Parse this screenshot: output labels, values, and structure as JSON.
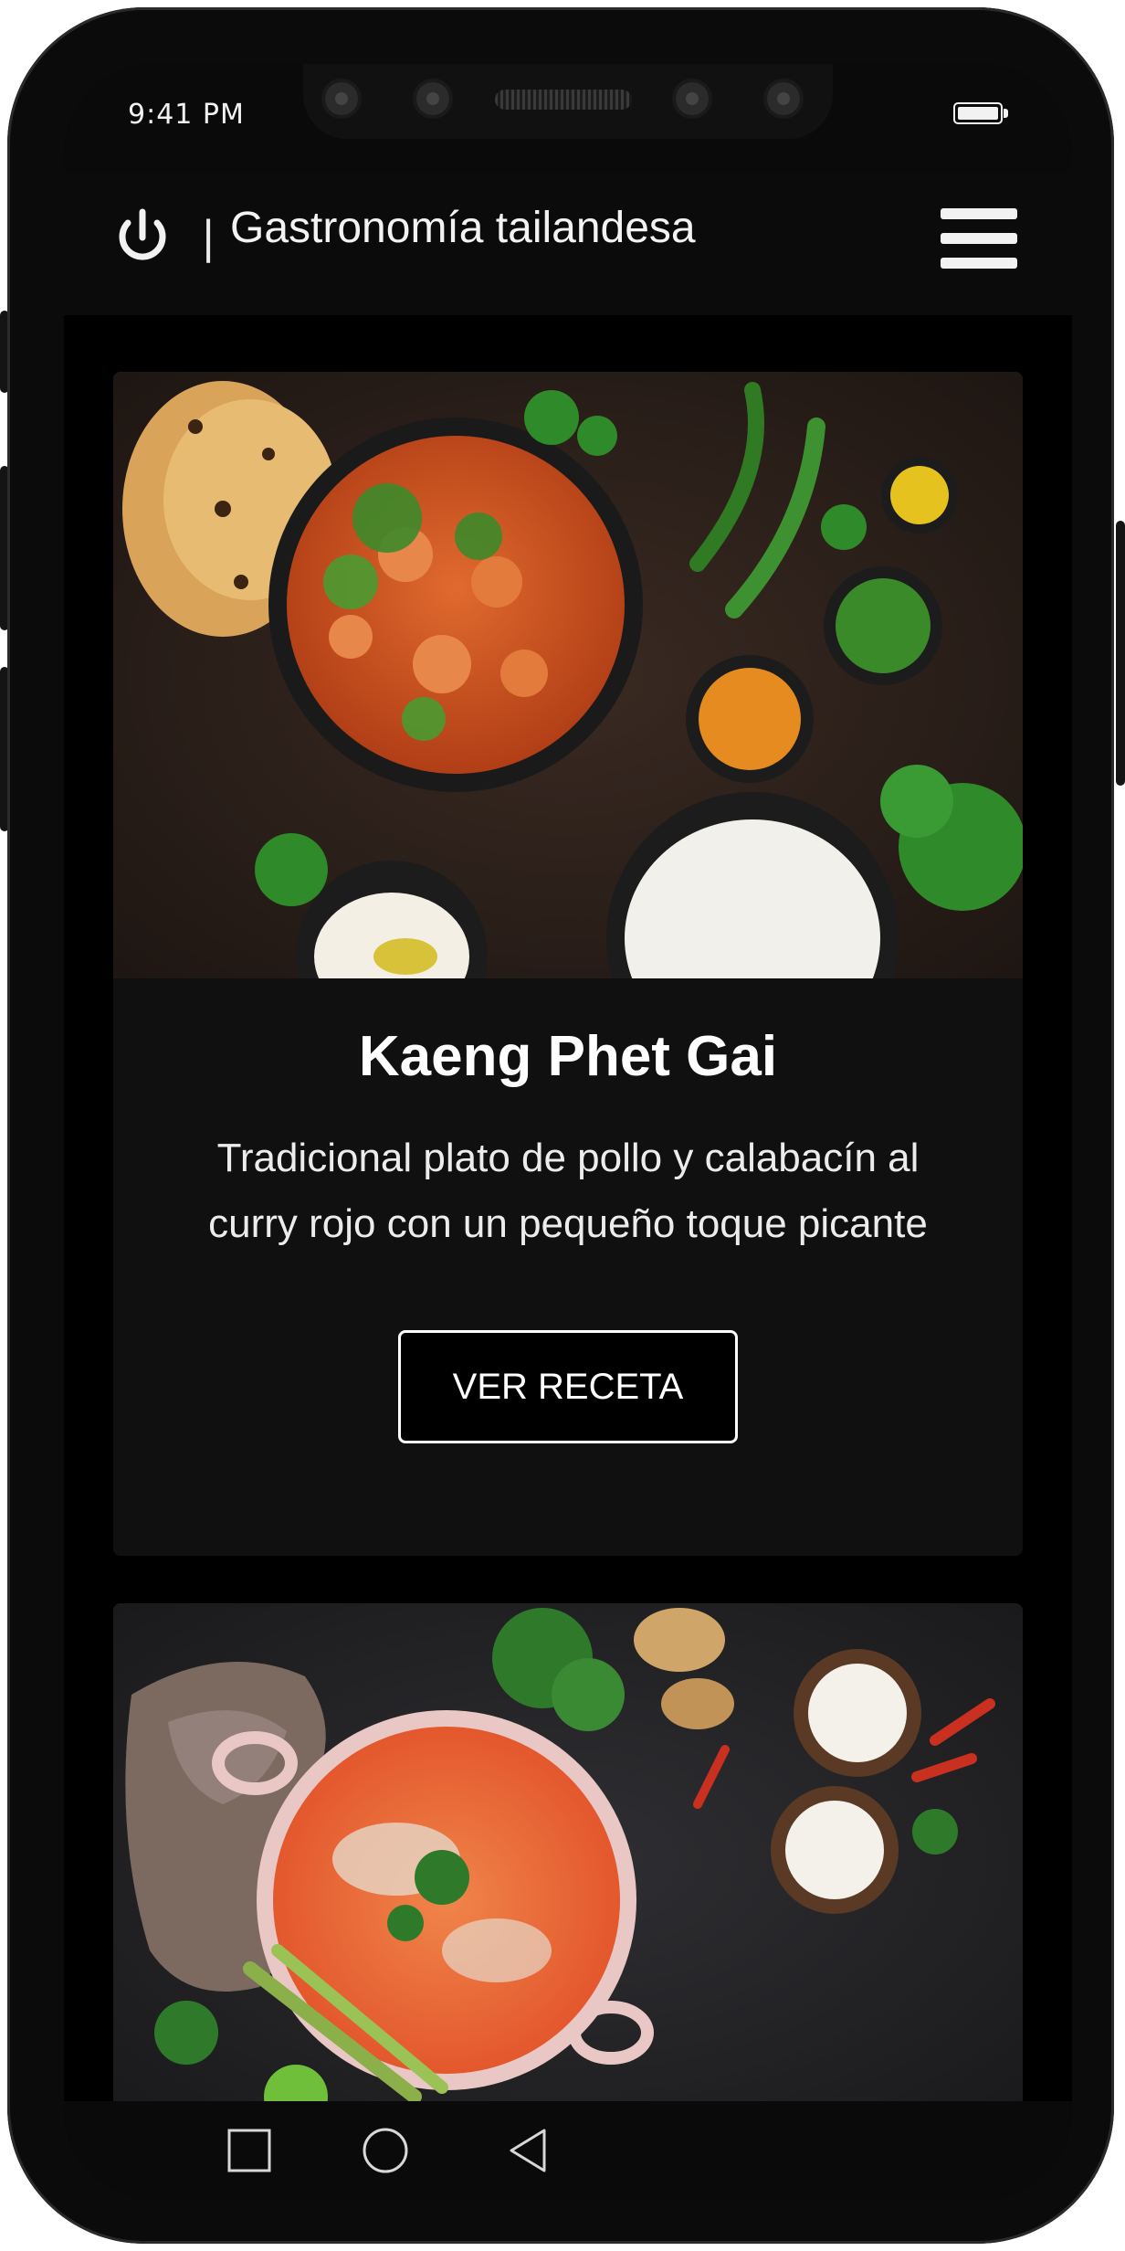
{
  "status_bar": {
    "time": "9:41 PM"
  },
  "header": {
    "title": "Gastronomía tailandesa",
    "separator": "|"
  },
  "cards": [
    {
      "title": "Kaeng Phet Gai",
      "description": "Tradicional plato de pollo y calabacín al curry rojo con un pequeño toque picante",
      "button_label": "VER RECETA",
      "image": "food-photo-red-curry-chicken"
    },
    {
      "image": "food-photo-coconut-curry-soup"
    }
  ],
  "colors": {
    "background": "#000000",
    "card": "#101010",
    "text": "#ffffff"
  }
}
